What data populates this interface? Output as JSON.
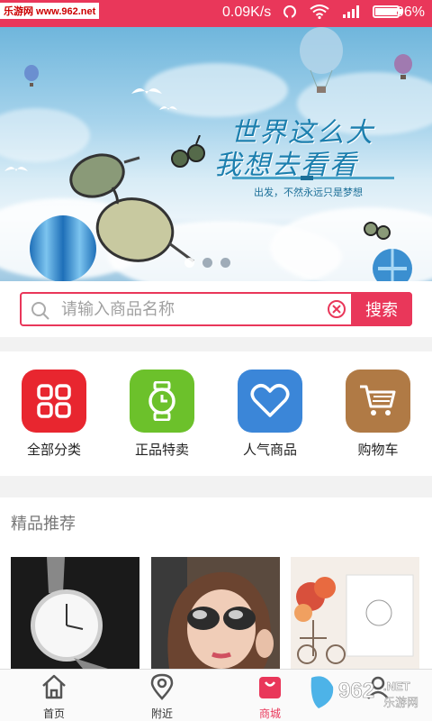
{
  "status_bar": {
    "watermark": "乐游网 www.962.net",
    "net_speed": "0.09K/s",
    "battery": "96%"
  },
  "banner": {
    "headline_line1": "世界这么大",
    "headline_line2": "我想去看看",
    "tagline": "出发，不然永远只是梦想",
    "slide_count": 3,
    "active_slide": 1
  },
  "search": {
    "placeholder": "请输入商品名称",
    "button_label": "搜索"
  },
  "categories": [
    {
      "label": "全部分类",
      "icon": "grid-icon",
      "color": "#e8262f"
    },
    {
      "label": "正品特卖",
      "icon": "watch-icon",
      "color": "#6cc12b"
    },
    {
      "label": "人气商品",
      "icon": "heart-icon",
      "color": "#3b86d8"
    },
    {
      "label": "购物车",
      "icon": "cart-icon",
      "color": "#b07a45"
    }
  ],
  "recommend": {
    "heading": "精品推荐",
    "items": [
      {
        "image": "watch-product"
      },
      {
        "image": "sunglasses-woman"
      },
      {
        "image": "flowers-bicycle"
      }
    ]
  },
  "bottom_nav": {
    "items": [
      {
        "label": "首页",
        "icon": "home-icon"
      },
      {
        "label": "附近",
        "icon": "location-pin-icon"
      },
      {
        "label": "商城",
        "icon": "shopping-bag-icon",
        "active": true
      },
      {
        "label": "",
        "icon": "user-icon"
      }
    ]
  },
  "colors": {
    "accent": "#e9375a"
  },
  "corner_watermark": "962.NET 乐游网"
}
